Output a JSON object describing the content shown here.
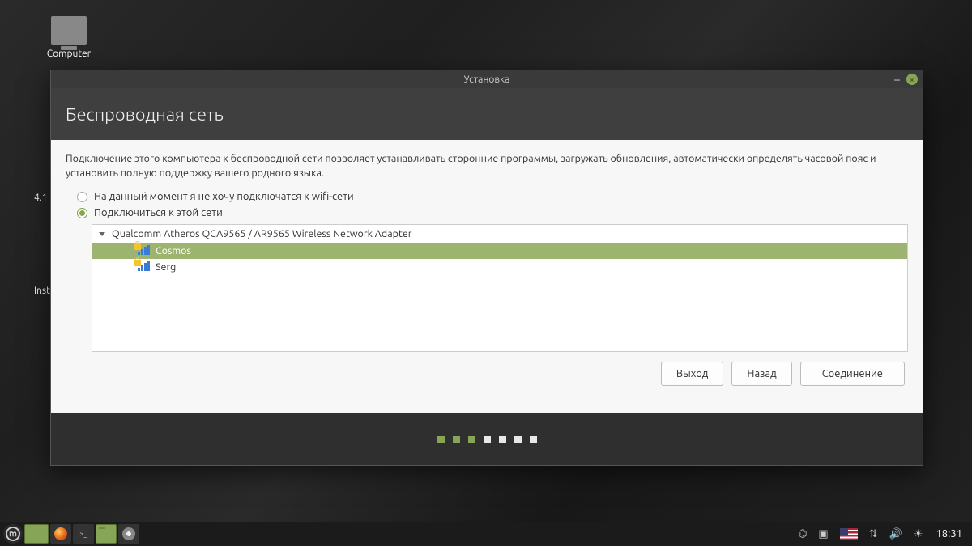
{
  "desktop": {
    "computer_label": "Computer",
    "partial_left_1": "4.1",
    "partial_left_2": "Inst"
  },
  "window": {
    "title": "Установка",
    "heading": "Беспроводная сеть",
    "description": "Подключение этого компьютера к беспроводной сети позволяет устанавливать сторонние программы, загружать обновления, автоматически определять часовой пояс и установить полную поддержку вашего родного языка.",
    "radio_no_wifi": "На данный момент я не хочу подключатся к wifi-сети",
    "radio_connect": "Подключиться к этой сети",
    "adapter": "Qualcomm Atheros QCA9565 / AR9565 Wireless Network Adapter",
    "networks": [
      {
        "ssid": "Cosmos",
        "selected": true,
        "secured": true
      },
      {
        "ssid": "Serg",
        "selected": false,
        "secured": true
      }
    ],
    "buttons": {
      "quit": "Выход",
      "back": "Назад",
      "connect": "Соединение"
    },
    "progress": {
      "total": 7,
      "current": 3
    }
  },
  "taskbar": {
    "clock": "18:31"
  }
}
